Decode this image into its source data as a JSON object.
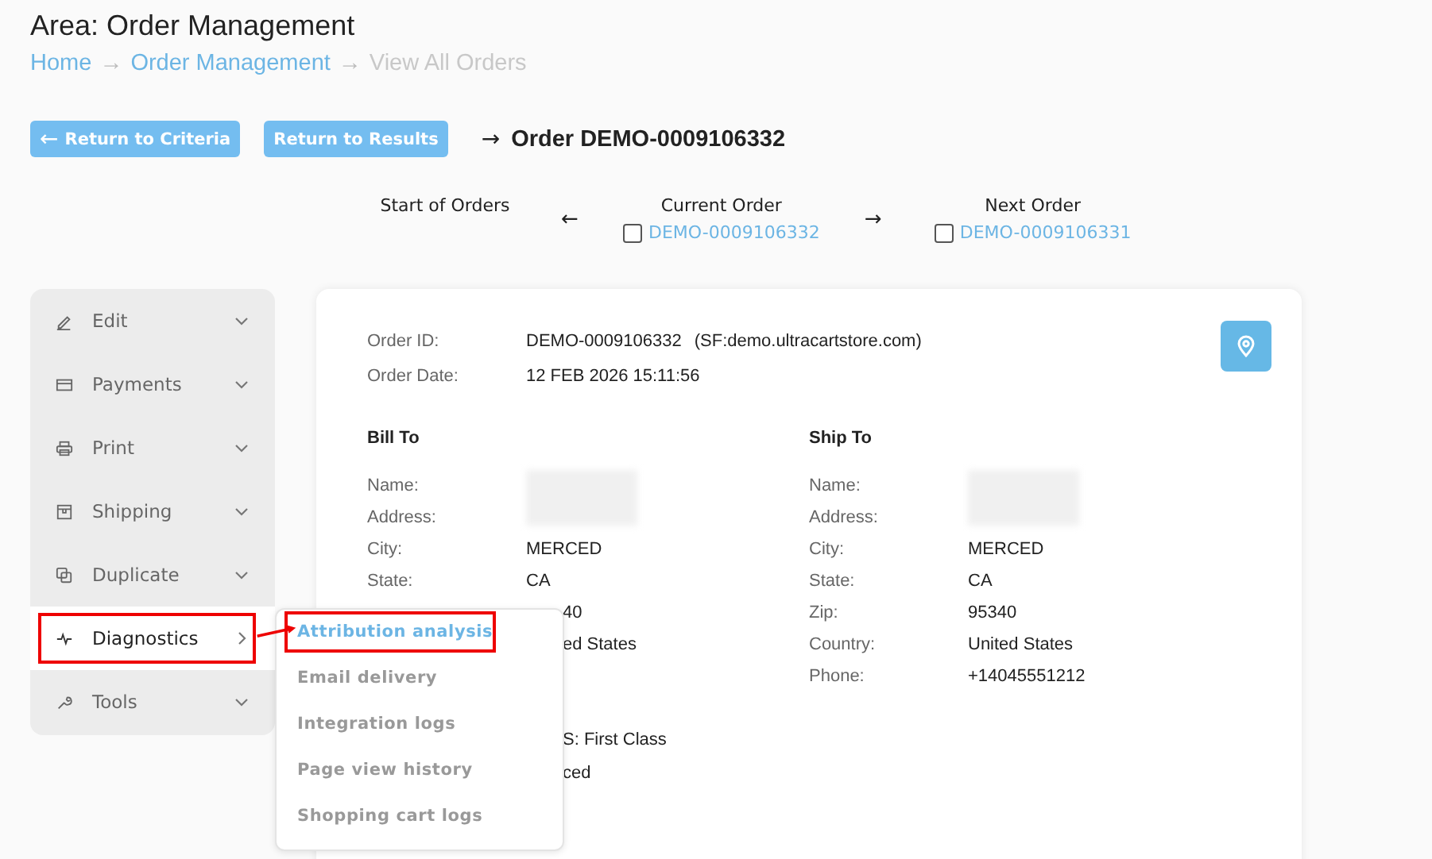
{
  "header": {
    "title": "Area: Order Management",
    "breadcrumb": [
      {
        "label": "Home",
        "kind": "link"
      },
      {
        "label": "Order Management",
        "kind": "link"
      },
      {
        "label": "View All Orders",
        "kind": "current"
      }
    ],
    "separator": "→"
  },
  "actions": {
    "buttons": [
      {
        "label": "Return to Criteria",
        "arrow": "←"
      },
      {
        "label": "Return to Results"
      }
    ],
    "order_arrow": "→",
    "order_title": "Order DEMO-0009106332"
  },
  "order_nav": {
    "start": {
      "label": "Start of Orders"
    },
    "prev_arrow": "←",
    "current": {
      "label": "Current Order",
      "order": "DEMO-0009106332",
      "checked": false
    },
    "next_arrow": "→",
    "next": {
      "label": "Next Order",
      "order": "DEMO-0009106331",
      "checked": false
    }
  },
  "sidebar": {
    "items": [
      {
        "label": "Edit",
        "expanded": false,
        "selected": false,
        "highlighted": false
      },
      {
        "label": "Payments",
        "expanded": false,
        "selected": false,
        "highlighted": false
      },
      {
        "label": "Print",
        "expanded": false,
        "selected": false,
        "highlighted": false
      },
      {
        "label": "Shipping",
        "expanded": false,
        "selected": false,
        "highlighted": false
      },
      {
        "label": "Duplicate",
        "expanded": false,
        "selected": false,
        "highlighted": false
      },
      {
        "label": "Diagnostics",
        "expanded": true,
        "selected": true,
        "highlighted": true
      },
      {
        "label": "Tools",
        "expanded": false,
        "selected": false,
        "highlighted": false
      }
    ]
  },
  "submenu": {
    "items": [
      {
        "label": "Attribution analysis",
        "selected": true,
        "highlighted": true
      },
      {
        "label": "Email delivery",
        "selected": false,
        "highlighted": false
      },
      {
        "label": "Integration logs",
        "selected": false,
        "highlighted": false
      },
      {
        "label": "Page view history",
        "selected": false,
        "highlighted": false
      },
      {
        "label": "Shopping cart logs",
        "selected": false,
        "highlighted": false
      }
    ]
  },
  "order": {
    "fields": [
      {
        "label": "Order ID:",
        "value": "DEMO-0009106332",
        "extra": "(SF:demo.ultracartstore.com)"
      },
      {
        "label": "Order Date:",
        "value": "12 FEB 2026 15:11:56"
      }
    ],
    "bill_to": {
      "title": "Bill To",
      "rows": [
        {
          "label": "Name:",
          "value": "",
          "kind": "redacted"
        },
        {
          "label": "Address:",
          "value": "",
          "kind": "redacted"
        },
        {
          "label": "City:",
          "value": "MERCED",
          "kind": "text"
        },
        {
          "label": "State:",
          "value": "CA",
          "kind": "text"
        },
        {
          "label": "",
          "value": "40",
          "kind": "partial"
        },
        {
          "label": "",
          "value": "ed States",
          "kind": "partial"
        }
      ]
    },
    "ship_to": {
      "title": "Ship To",
      "rows": [
        {
          "label": "Name:",
          "value": "",
          "kind": "redacted"
        },
        {
          "label": "Address:",
          "value": "",
          "kind": "redacted"
        },
        {
          "label": "City:",
          "value": "MERCED",
          "kind": "text"
        },
        {
          "label": "State:",
          "value": "CA",
          "kind": "text"
        },
        {
          "label": "Zip:",
          "value": "95340",
          "kind": "text"
        },
        {
          "label": "Country:",
          "value": "United States",
          "kind": "text"
        },
        {
          "label": "Phone:",
          "value": "+14045551212",
          "kind": "text"
        }
      ]
    },
    "lower_rows": [
      {
        "value": "S: First Class"
      },
      {
        "value": "ced"
      }
    ]
  }
}
